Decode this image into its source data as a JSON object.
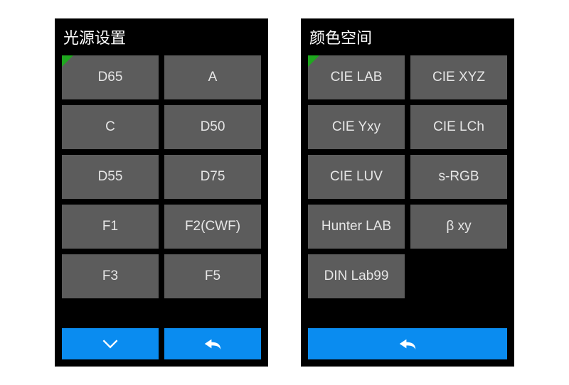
{
  "left": {
    "title": "光源设置",
    "options": [
      "D65",
      "A",
      "C",
      "D50",
      "D55",
      "D75",
      "F1",
      "F2(CWF)",
      "F3",
      "F5"
    ],
    "buttons": [
      "down",
      "back"
    ]
  },
  "right": {
    "title": "颜色空间",
    "options": [
      "CIE LAB",
      "CIE XYZ",
      "CIE Yxy",
      "CIE LCh",
      "CIE LUV",
      "s-RGB",
      "Hunter LAB",
      "β xy",
      "DIN Lab99"
    ],
    "buttons": [
      "back"
    ]
  },
  "colors": {
    "panel_bg": "#000000",
    "button_bg": "#5c5c5c",
    "accent": "#0a8cf0",
    "corner": "#1fa81f"
  }
}
